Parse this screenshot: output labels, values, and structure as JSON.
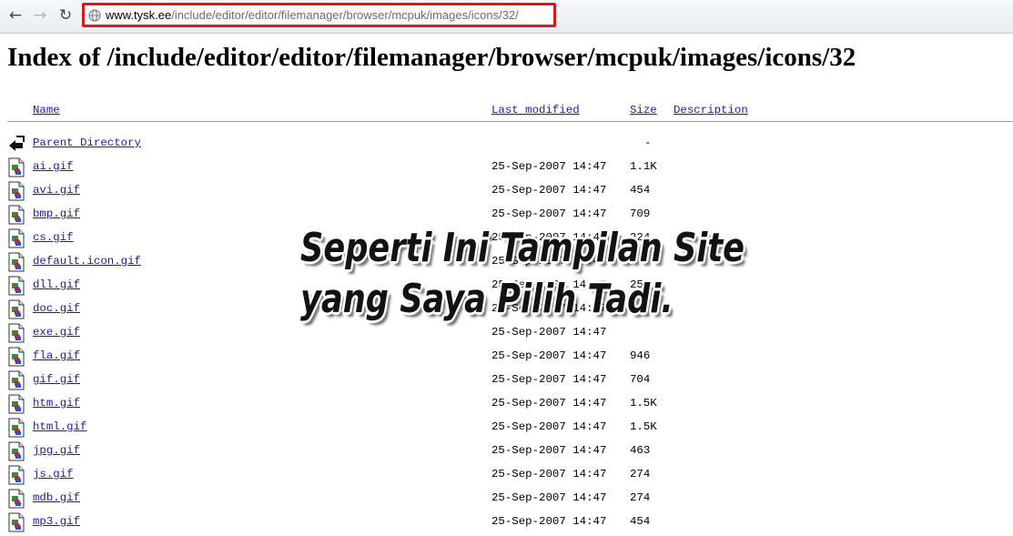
{
  "toolbar": {
    "back_icon": "back-arrow-icon",
    "forward_icon": "forward-arrow-icon",
    "reload_icon": "reload-icon",
    "url_host": "www.tysk.ee",
    "url_path": "/include/editor/editor/filemanager/browser/mcpuk/images/icons/32/",
    "highlight_color": "#e0141b"
  },
  "page": {
    "title": "Index of /include/editor/editor/filemanager/browser/mcpuk/images/icons/32"
  },
  "table": {
    "headers": {
      "name": "Name",
      "modified": "Last modified",
      "size": "Size",
      "description": "Description"
    },
    "rows": [
      {
        "name": "Parent Directory",
        "modified": "",
        "size": "-",
        "icon": "back-icon"
      },
      {
        "name": "ai.gif",
        "modified": "25-Sep-2007 14:47",
        "size": "1.1K",
        "icon": "image-file-icon"
      },
      {
        "name": "avi.gif",
        "modified": "25-Sep-2007 14:47",
        "size": "454",
        "icon": "image-file-icon"
      },
      {
        "name": "bmp.gif",
        "modified": "25-Sep-2007 14:47",
        "size": "709",
        "icon": "image-file-icon"
      },
      {
        "name": "cs.gif",
        "modified": "25-Sep-2007 14:47",
        "size": "224",
        "icon": "image-file-icon"
      },
      {
        "name": "default.icon.gif",
        "modified": "25-Sep-2007 14:47",
        "size": "",
        "icon": "image-file-icon"
      },
      {
        "name": "dll.gif",
        "modified": "25-Sep-2007 14:47",
        "size": "258",
        "icon": "image-file-icon"
      },
      {
        "name": "doc.gif",
        "modified": "25-Sep-2007 14:47",
        "size": "",
        "icon": "image-file-icon"
      },
      {
        "name": "exe.gif",
        "modified": "25-Sep-2007 14:47",
        "size": "",
        "icon": "image-file-icon"
      },
      {
        "name": "fla.gif",
        "modified": "25-Sep-2007 14:47",
        "size": "946",
        "icon": "image-file-icon"
      },
      {
        "name": "gif.gif",
        "modified": "25-Sep-2007 14:47",
        "size": "704",
        "icon": "image-file-icon"
      },
      {
        "name": "htm.gif",
        "modified": "25-Sep-2007 14:47",
        "size": "1.5K",
        "icon": "image-file-icon"
      },
      {
        "name": "html.gif",
        "modified": "25-Sep-2007 14:47",
        "size": "1.5K",
        "icon": "image-file-icon"
      },
      {
        "name": "jpg.gif",
        "modified": "25-Sep-2007 14:47",
        "size": "463",
        "icon": "image-file-icon"
      },
      {
        "name": "js.gif",
        "modified": "25-Sep-2007 14:47",
        "size": "274",
        "icon": "image-file-icon"
      },
      {
        "name": "mdb.gif",
        "modified": "25-Sep-2007 14:47",
        "size": "274",
        "icon": "image-file-icon"
      },
      {
        "name": "mp3.gif",
        "modified": "25-Sep-2007 14:47",
        "size": "454",
        "icon": "image-file-icon"
      }
    ]
  },
  "overlay": {
    "line1": "Seperti Ini Tampilan Site",
    "line2": "yang Saya Pilih Tadi."
  },
  "colors": {
    "link": "#1c1ca0",
    "rule": "#9a9a9a"
  }
}
